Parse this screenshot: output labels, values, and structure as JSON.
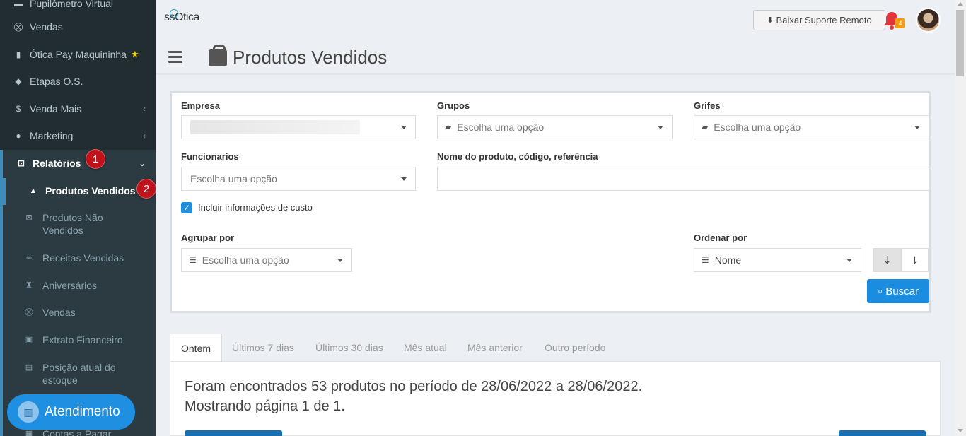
{
  "sidebar": {
    "items": [
      {
        "label": "Pupilômetro Virtual",
        "icon": "ruler-icon"
      },
      {
        "label": "Vendas",
        "icon": "basket-icon"
      },
      {
        "label": "Ótica Pay Maquininha",
        "icon": "card-machine-icon"
      },
      {
        "label": "Etapas O.S.",
        "icon": "tag-icon"
      },
      {
        "label": "Venda Mais",
        "icon": "dollar-icon"
      },
      {
        "label": "Marketing",
        "icon": "chat-icon"
      },
      {
        "label": "Relatórios",
        "icon": "report-icon"
      }
    ],
    "subitems": [
      {
        "label": "Produtos Vendidos",
        "icon": "shopping-bag-icon"
      },
      {
        "label": "Produtos Não Vendidos",
        "icon": "box-x-icon"
      },
      {
        "label": "Receitas Vencidas",
        "icon": "glasses-icon"
      },
      {
        "label": "Aniversários",
        "icon": "cake-icon"
      },
      {
        "label": "Vendas",
        "icon": "basket-icon"
      },
      {
        "label": "Extrato Financeiro",
        "icon": "money-icon"
      },
      {
        "label": "Posição atual do estoque",
        "icon": "file-icon"
      },
      {
        "label": "Contas a Pagar",
        "icon": "calculator-icon"
      }
    ],
    "badges": [
      "1",
      "2"
    ],
    "atendimento": "Atendimento"
  },
  "topbar": {
    "logo": "ssOtica",
    "suporte_label": "Baixar Suporte Remoto",
    "notifications": "4"
  },
  "page": {
    "title": "Produtos Vendidos"
  },
  "filters": {
    "empresa_label": "Empresa",
    "empresa_value": "",
    "grupos_label": "Grupos",
    "grupos_placeholder": "Escolha uma opção",
    "grifes_label": "Grifes",
    "grifes_placeholder": "Escolha uma opção",
    "funcionarios_label": "Funcionarios",
    "funcionarios_placeholder": "Escolha uma opção",
    "nome_label": "Nome do produto, código, referência",
    "nome_value": "",
    "incluir_custo_label": "Incluir informações de custo",
    "incluir_custo_checked": true,
    "agrupar_label": "Agrupar por",
    "agrupar_placeholder": "Escolha uma opção",
    "ordenar_label": "Ordenar por",
    "ordenar_value": "Nome",
    "buscar_label": "Buscar"
  },
  "tabs": [
    "Ontem",
    "Últimos 7 dias",
    "Últimos 30 dias",
    "Mês atual",
    "Mês anterior",
    "Outro período"
  ],
  "results": {
    "line1": "Foram encontrados 53 produtos no período de 28/06/2022 a 28/06/2022.",
    "line2": "Mostrando página 1 de 1."
  },
  "colors": {
    "sidebar_bg": "#222d32",
    "accent": "#1a8de0",
    "badge_red": "#c0121a",
    "notification_orange": "#f39c12"
  }
}
